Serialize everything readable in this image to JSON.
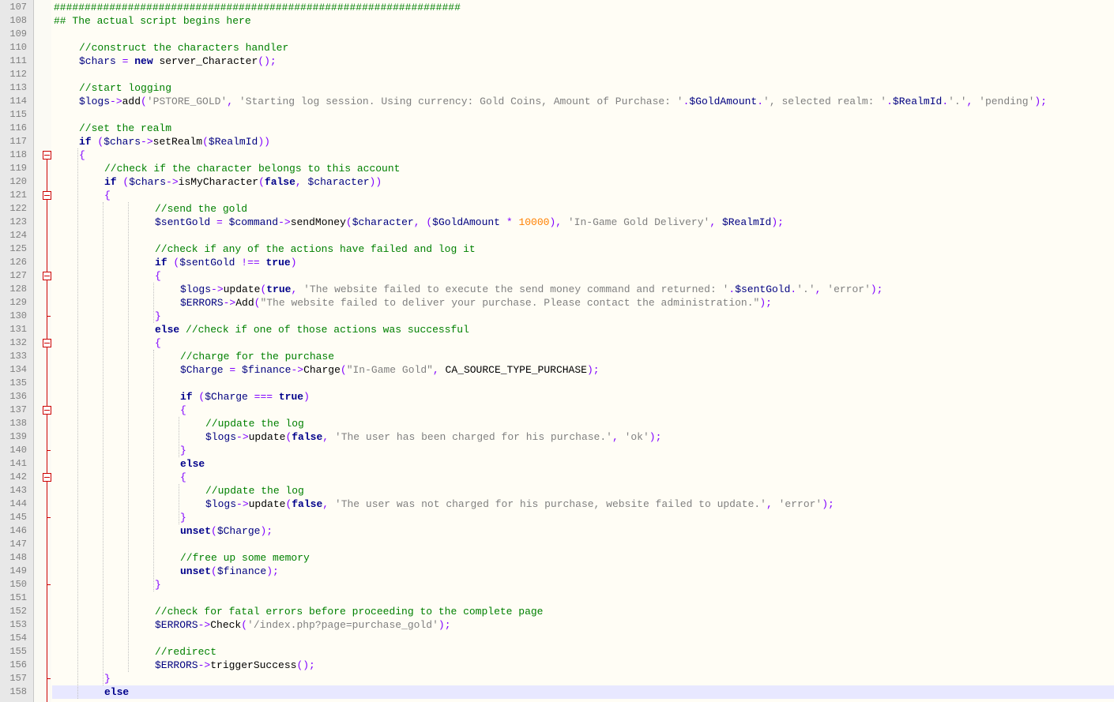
{
  "editor": {
    "lines": [
      {
        "n": "107",
        "indent": 0,
        "tokens": [
          [
            "com",
            "##################################################################"
          ]
        ]
      },
      {
        "n": "108",
        "indent": 0,
        "tokens": [
          [
            "com",
            "## The actual script begins here"
          ]
        ]
      },
      {
        "n": "109",
        "indent": 0,
        "tokens": []
      },
      {
        "n": "110",
        "indent": 4,
        "tokens": [
          [
            "com",
            "//construct the characters handler"
          ]
        ]
      },
      {
        "n": "111",
        "indent": 4,
        "tokens": [
          [
            "var",
            "$chars"
          ],
          [
            "plain",
            " "
          ],
          [
            "op",
            "="
          ],
          [
            "plain",
            " "
          ],
          [
            "kw",
            "new"
          ],
          [
            "plain",
            " server_Character"
          ],
          [
            "op",
            "();"
          ]
        ]
      },
      {
        "n": "112",
        "indent": 0,
        "tokens": []
      },
      {
        "n": "113",
        "indent": 4,
        "tokens": [
          [
            "com",
            "//start logging"
          ]
        ]
      },
      {
        "n": "114",
        "indent": 4,
        "tokens": [
          [
            "var",
            "$logs"
          ],
          [
            "op",
            "->"
          ],
          [
            "plain",
            "add"
          ],
          [
            "op",
            "("
          ],
          [
            "str",
            "'PSTORE_GOLD'"
          ],
          [
            "op",
            ","
          ],
          [
            "plain",
            " "
          ],
          [
            "str",
            "'Starting log session. Using currency: Gold Coins, Amount of Purchase: '"
          ],
          [
            "op",
            "."
          ],
          [
            "var",
            "$GoldAmount"
          ],
          [
            "op",
            "."
          ],
          [
            "str",
            "', selected realm: '"
          ],
          [
            "op",
            "."
          ],
          [
            "var",
            "$RealmId"
          ],
          [
            "op",
            "."
          ],
          [
            "str",
            "'.'"
          ],
          [
            "op",
            ","
          ],
          [
            "plain",
            " "
          ],
          [
            "str",
            "'pending'"
          ],
          [
            "op",
            ");"
          ]
        ]
      },
      {
        "n": "115",
        "indent": 0,
        "tokens": []
      },
      {
        "n": "116",
        "indent": 4,
        "tokens": [
          [
            "com",
            "//set the realm"
          ]
        ]
      },
      {
        "n": "117",
        "indent": 4,
        "tokens": [
          [
            "kw",
            "if"
          ],
          [
            "plain",
            " "
          ],
          [
            "op",
            "("
          ],
          [
            "var",
            "$chars"
          ],
          [
            "op",
            "->"
          ],
          [
            "plain",
            "setRealm"
          ],
          [
            "op",
            "("
          ],
          [
            "var",
            "$RealmId"
          ],
          [
            "op",
            "))"
          ]
        ]
      },
      {
        "n": "118",
        "indent": 4,
        "tokens": [
          [
            "op",
            "{"
          ]
        ]
      },
      {
        "n": "119",
        "indent": 8,
        "tokens": [
          [
            "com",
            "//check if the character belongs to this account"
          ]
        ]
      },
      {
        "n": "120",
        "indent": 8,
        "tokens": [
          [
            "kw",
            "if"
          ],
          [
            "plain",
            " "
          ],
          [
            "op",
            "("
          ],
          [
            "var",
            "$chars"
          ],
          [
            "op",
            "->"
          ],
          [
            "plain",
            "isMyCharacter"
          ],
          [
            "op",
            "("
          ],
          [
            "kw",
            "false"
          ],
          [
            "op",
            ","
          ],
          [
            "plain",
            " "
          ],
          [
            "var",
            "$character"
          ],
          [
            "op",
            "))"
          ]
        ]
      },
      {
        "n": "121",
        "indent": 8,
        "tokens": [
          [
            "op",
            "{"
          ]
        ]
      },
      {
        "n": "122",
        "indent": 16,
        "tokens": [
          [
            "com",
            "//send the gold"
          ]
        ]
      },
      {
        "n": "123",
        "indent": 16,
        "tokens": [
          [
            "var",
            "$sentGold"
          ],
          [
            "plain",
            " "
          ],
          [
            "op",
            "="
          ],
          [
            "plain",
            " "
          ],
          [
            "var",
            "$command"
          ],
          [
            "op",
            "->"
          ],
          [
            "plain",
            "sendMoney"
          ],
          [
            "op",
            "("
          ],
          [
            "var",
            "$character"
          ],
          [
            "op",
            ","
          ],
          [
            "plain",
            " "
          ],
          [
            "op",
            "("
          ],
          [
            "var",
            "$GoldAmount"
          ],
          [
            "plain",
            " "
          ],
          [
            "op",
            "*"
          ],
          [
            "plain",
            " "
          ],
          [
            "num",
            "10000"
          ],
          [
            "op",
            "),"
          ],
          [
            "plain",
            " "
          ],
          [
            "str",
            "'In-Game Gold Delivery'"
          ],
          [
            "op",
            ","
          ],
          [
            "plain",
            " "
          ],
          [
            "var",
            "$RealmId"
          ],
          [
            "op",
            ");"
          ]
        ]
      },
      {
        "n": "124",
        "indent": 0,
        "tokens": []
      },
      {
        "n": "125",
        "indent": 16,
        "tokens": [
          [
            "com",
            "//check if any of the actions have failed and log it"
          ]
        ]
      },
      {
        "n": "126",
        "indent": 16,
        "tokens": [
          [
            "kw",
            "if"
          ],
          [
            "plain",
            " "
          ],
          [
            "op",
            "("
          ],
          [
            "var",
            "$sentGold"
          ],
          [
            "plain",
            " "
          ],
          [
            "op",
            "!=="
          ],
          [
            "plain",
            " "
          ],
          [
            "kw",
            "true"
          ],
          [
            "op",
            ")"
          ]
        ]
      },
      {
        "n": "127",
        "indent": 16,
        "tokens": [
          [
            "op",
            "{"
          ]
        ]
      },
      {
        "n": "128",
        "indent": 20,
        "tokens": [
          [
            "var",
            "$logs"
          ],
          [
            "op",
            "->"
          ],
          [
            "plain",
            "update"
          ],
          [
            "op",
            "("
          ],
          [
            "kw",
            "true"
          ],
          [
            "op",
            ","
          ],
          [
            "plain",
            " "
          ],
          [
            "str",
            "'The website failed to execute the send money command and returned: '"
          ],
          [
            "op",
            "."
          ],
          [
            "var",
            "$sentGold"
          ],
          [
            "op",
            "."
          ],
          [
            "str",
            "'.'"
          ],
          [
            "op",
            ","
          ],
          [
            "plain",
            " "
          ],
          [
            "str",
            "'error'"
          ],
          [
            "op",
            ");"
          ]
        ]
      },
      {
        "n": "129",
        "indent": 20,
        "tokens": [
          [
            "var",
            "$ERRORS"
          ],
          [
            "op",
            "->"
          ],
          [
            "plain",
            "Add"
          ],
          [
            "op",
            "("
          ],
          [
            "str",
            "\"The website failed to deliver your purchase. Please contact the administration.\""
          ],
          [
            "op",
            ");"
          ]
        ]
      },
      {
        "n": "130",
        "indent": 16,
        "tokens": [
          [
            "op",
            "}"
          ]
        ]
      },
      {
        "n": "131",
        "indent": 16,
        "tokens": [
          [
            "kw",
            "else"
          ],
          [
            "plain",
            " "
          ],
          [
            "com",
            "//check if one of those actions was successful"
          ]
        ]
      },
      {
        "n": "132",
        "indent": 16,
        "tokens": [
          [
            "op",
            "{"
          ]
        ]
      },
      {
        "n": "133",
        "indent": 20,
        "tokens": [
          [
            "com",
            "//charge for the purchase"
          ]
        ]
      },
      {
        "n": "134",
        "indent": 20,
        "tokens": [
          [
            "var",
            "$Charge"
          ],
          [
            "plain",
            " "
          ],
          [
            "op",
            "="
          ],
          [
            "plain",
            " "
          ],
          [
            "var",
            "$finance"
          ],
          [
            "op",
            "->"
          ],
          [
            "plain",
            "Charge"
          ],
          [
            "op",
            "("
          ],
          [
            "str",
            "\"In-Game Gold\""
          ],
          [
            "op",
            ","
          ],
          [
            "plain",
            " CA_SOURCE_TYPE_PURCHASE"
          ],
          [
            "op",
            ");"
          ]
        ]
      },
      {
        "n": "135",
        "indent": 0,
        "tokens": []
      },
      {
        "n": "136",
        "indent": 20,
        "tokens": [
          [
            "kw",
            "if"
          ],
          [
            "plain",
            " "
          ],
          [
            "op",
            "("
          ],
          [
            "var",
            "$Charge"
          ],
          [
            "plain",
            " "
          ],
          [
            "op",
            "==="
          ],
          [
            "plain",
            " "
          ],
          [
            "kw",
            "true"
          ],
          [
            "op",
            ")"
          ]
        ]
      },
      {
        "n": "137",
        "indent": 20,
        "tokens": [
          [
            "op",
            "{"
          ]
        ]
      },
      {
        "n": "138",
        "indent": 24,
        "tokens": [
          [
            "com",
            "//update the log"
          ]
        ]
      },
      {
        "n": "139",
        "indent": 24,
        "tokens": [
          [
            "var",
            "$logs"
          ],
          [
            "op",
            "->"
          ],
          [
            "plain",
            "update"
          ],
          [
            "op",
            "("
          ],
          [
            "kw",
            "false"
          ],
          [
            "op",
            ","
          ],
          [
            "plain",
            " "
          ],
          [
            "str",
            "'The user has been charged for his purchase.'"
          ],
          [
            "op",
            ","
          ],
          [
            "plain",
            " "
          ],
          [
            "str",
            "'ok'"
          ],
          [
            "op",
            ");"
          ]
        ]
      },
      {
        "n": "140",
        "indent": 20,
        "tokens": [
          [
            "op",
            "}"
          ]
        ]
      },
      {
        "n": "141",
        "indent": 20,
        "tokens": [
          [
            "kw",
            "else"
          ]
        ]
      },
      {
        "n": "142",
        "indent": 20,
        "tokens": [
          [
            "op",
            "{"
          ]
        ]
      },
      {
        "n": "143",
        "indent": 24,
        "tokens": [
          [
            "com",
            "//update the log"
          ]
        ]
      },
      {
        "n": "144",
        "indent": 24,
        "tokens": [
          [
            "var",
            "$logs"
          ],
          [
            "op",
            "->"
          ],
          [
            "plain",
            "update"
          ],
          [
            "op",
            "("
          ],
          [
            "kw",
            "false"
          ],
          [
            "op",
            ","
          ],
          [
            "plain",
            " "
          ],
          [
            "str",
            "'The user was not charged for his purchase, website failed to update.'"
          ],
          [
            "op",
            ","
          ],
          [
            "plain",
            " "
          ],
          [
            "str",
            "'error'"
          ],
          [
            "op",
            ");"
          ]
        ]
      },
      {
        "n": "145",
        "indent": 20,
        "tokens": [
          [
            "op",
            "}"
          ]
        ]
      },
      {
        "n": "146",
        "indent": 20,
        "tokens": [
          [
            "kw",
            "unset"
          ],
          [
            "op",
            "("
          ],
          [
            "var",
            "$Charge"
          ],
          [
            "op",
            ");"
          ]
        ]
      },
      {
        "n": "147",
        "indent": 0,
        "tokens": []
      },
      {
        "n": "148",
        "indent": 20,
        "tokens": [
          [
            "com",
            "//free up some memory"
          ]
        ]
      },
      {
        "n": "149",
        "indent": 20,
        "tokens": [
          [
            "kw",
            "unset"
          ],
          [
            "op",
            "("
          ],
          [
            "var",
            "$finance"
          ],
          [
            "op",
            ");"
          ]
        ]
      },
      {
        "n": "150",
        "indent": 16,
        "tokens": [
          [
            "op",
            "}"
          ]
        ]
      },
      {
        "n": "151",
        "indent": 0,
        "tokens": []
      },
      {
        "n": "152",
        "indent": 16,
        "tokens": [
          [
            "com",
            "//check for fatal errors before proceeding to the complete page"
          ]
        ]
      },
      {
        "n": "153",
        "indent": 16,
        "tokens": [
          [
            "var",
            "$ERRORS"
          ],
          [
            "op",
            "->"
          ],
          [
            "plain",
            "Check"
          ],
          [
            "op",
            "("
          ],
          [
            "str",
            "'/index.php?page=purchase_gold'"
          ],
          [
            "op",
            ");"
          ]
        ]
      },
      {
        "n": "154",
        "indent": 0,
        "tokens": []
      },
      {
        "n": "155",
        "indent": 16,
        "tokens": [
          [
            "com",
            "//redirect"
          ]
        ]
      },
      {
        "n": "156",
        "indent": 16,
        "tokens": [
          [
            "var",
            "$ERRORS"
          ],
          [
            "op",
            "->"
          ],
          [
            "plain",
            "triggerSuccess"
          ],
          [
            "op",
            "();"
          ]
        ]
      },
      {
        "n": "157",
        "indent": 8,
        "tokens": [
          [
            "op",
            "}"
          ]
        ]
      },
      {
        "n": "158",
        "indent": 8,
        "tokens": [
          [
            "kw",
            "else"
          ]
        ]
      }
    ],
    "fold_open_lines": [
      "118",
      "121",
      "127",
      "132",
      "137",
      "142"
    ],
    "fold_close_lines": [
      "130",
      "140",
      "145",
      "150",
      "157"
    ],
    "highlighted_line": "158",
    "colors": {
      "comment": "#008000",
      "keyword": "#00008b",
      "variable": "#000080",
      "operator": "#8000ff",
      "string": "#808080",
      "number": "#ff8000",
      "fold_marker": "#cc0000",
      "current_line": "#e8e8ff",
      "gutter": "#e8e8e8",
      "background": "#fffdf5"
    }
  }
}
